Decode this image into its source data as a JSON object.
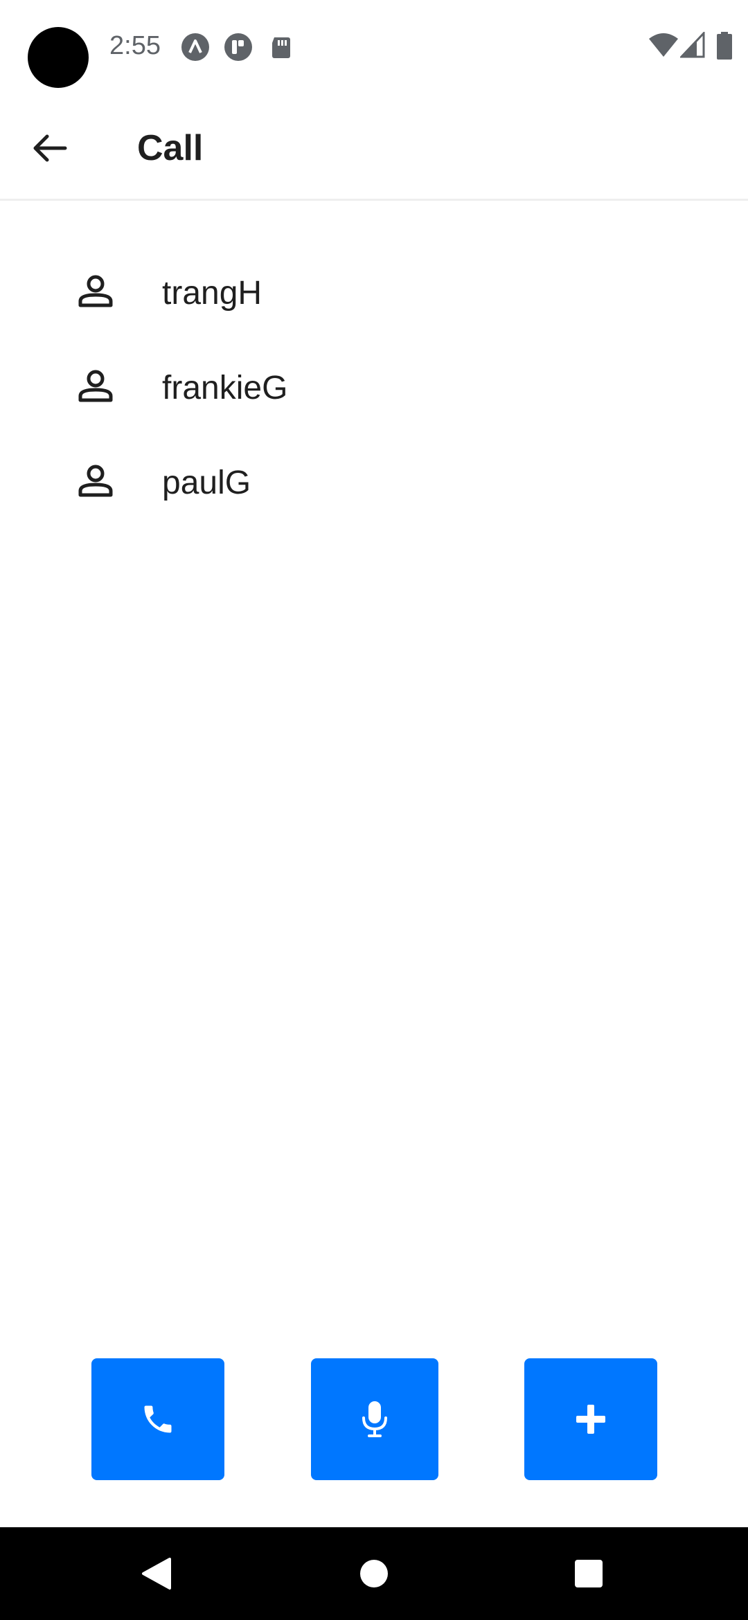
{
  "status_bar": {
    "time": "2:55",
    "icons": [
      "app-a-icon",
      "app-t-icon",
      "sd-card-icon",
      "wifi-icon",
      "signal-icon",
      "battery-icon"
    ]
  },
  "app_bar": {
    "title": "Call",
    "back_icon": "arrow-back-icon"
  },
  "contacts": [
    {
      "name": "trangH",
      "icon": "person-icon"
    },
    {
      "name": "frankieG",
      "icon": "person-icon"
    },
    {
      "name": "paulG",
      "icon": "person-icon"
    }
  ],
  "actions": [
    {
      "id": "call",
      "icon": "phone-icon"
    },
    {
      "id": "voice",
      "icon": "microphone-icon"
    },
    {
      "id": "add",
      "icon": "plus-icon"
    }
  ],
  "navigation": {
    "buttons": [
      "back-triangle-icon",
      "home-circle-icon",
      "recents-square-icon"
    ]
  },
  "colors": {
    "accent": "#0077ff",
    "text_primary": "#1f1f1f",
    "status_text": "#5f6368",
    "nav_bar": "#000000"
  }
}
